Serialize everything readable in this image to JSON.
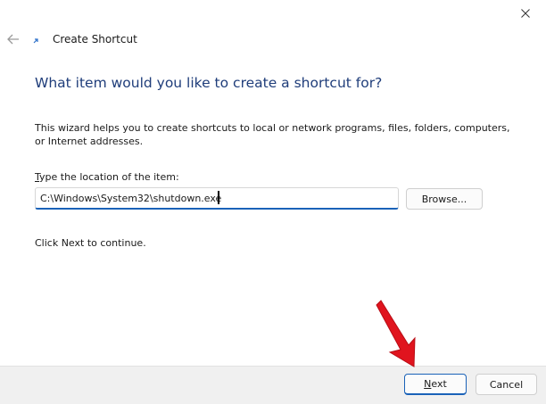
{
  "window": {
    "title": "Create Shortcut"
  },
  "icons": {
    "close": "close-icon",
    "back": "back-arrow-icon",
    "app": "shortcut-icon"
  },
  "wizard": {
    "heading": "What item would you like to create a shortcut for?",
    "description": "This wizard helps you to create shortcuts to local or network programs, files, folders, computers, or Internet addresses.",
    "location_label_accel": "T",
    "location_label_rest": "ype the location of the item:",
    "location_value": "C:\\Windows\\System32\\shutdown.exe",
    "browse_accel": "Browse",
    "browse_rest": "...",
    "hint": "Click Next to continue."
  },
  "footer": {
    "next_accel": "N",
    "next_rest": "ext",
    "cancel_label": "Cancel"
  },
  "colors": {
    "heading": "#1f3d7a",
    "accent": "#1a62b8",
    "annotation_arrow": "#e0141e",
    "footer_bg": "#f0f0f0"
  }
}
